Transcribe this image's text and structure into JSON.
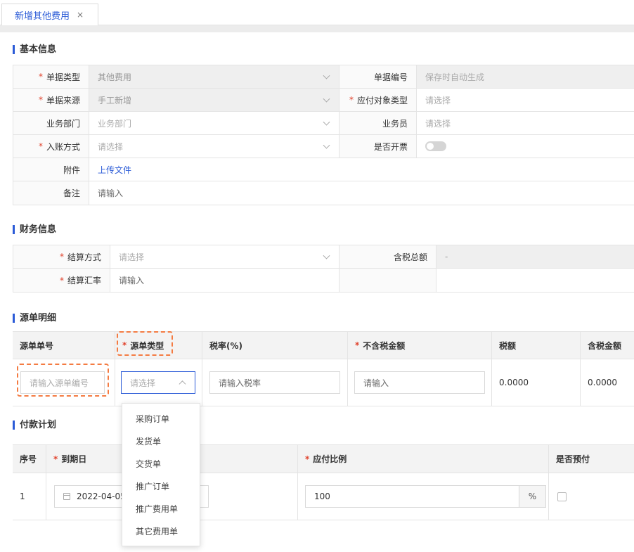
{
  "tab": {
    "label": "新增其他费用",
    "close": "×"
  },
  "basic": {
    "title": "基本信息",
    "doc_type_label": "单据类型",
    "doc_type_value": "其他费用",
    "doc_no_label": "单据编号",
    "doc_no_placeholder": "保存时自动生成",
    "doc_source_label": "单据来源",
    "doc_source_value": "手工新增",
    "payable_type_label": "应付对象类型",
    "payable_type_placeholder": "请选择",
    "dept_label": "业务部门",
    "dept_placeholder": "业务部门",
    "salesman_label": "业务员",
    "salesman_placeholder": "请选择",
    "entry_label": "入账方式",
    "entry_placeholder": "请选择",
    "invoice_label": "是否开票",
    "attach_label": "附件",
    "attach_link": "上传文件",
    "remark_label": "备注",
    "remark_placeholder": "请输入"
  },
  "finance": {
    "title": "财务信息",
    "settle_method_label": "结算方式",
    "settle_method_placeholder": "请选择",
    "tax_total_label": "含税总额",
    "tax_total_value": "-",
    "settle_rate_label": "结算汇率",
    "settle_rate_placeholder": "请输入"
  },
  "source": {
    "title": "源单明细",
    "headers": {
      "doc_no": "源单单号",
      "doc_type": "源单类型",
      "tax_rate": "税率(%)",
      "amount_ex": "不含税金额",
      "tax": "税额",
      "amount_inc": "含税金额"
    },
    "doc_no_placeholder": "请输入源单编号",
    "doc_type_placeholder": "请选择",
    "tax_rate_placeholder": "请输入税率",
    "amount_placeholder": "请输入",
    "tax_value": "0.0000",
    "amount_inc_value": "0.0000",
    "options": [
      "采购订单",
      "发货单",
      "交货单",
      "推广订单",
      "推广费用单",
      "其它费用单"
    ]
  },
  "plan": {
    "title": "付款计划",
    "headers": {
      "seq": "序号",
      "due": "到期日",
      "ratio": "应付比例",
      "prepay": "是否预付"
    },
    "row": {
      "seq": "1",
      "due": "2022-04-05",
      "ratio": "100",
      "unit": "%"
    }
  },
  "colors": {
    "accent": "#2b5bd7",
    "required": "#e0422c",
    "highlight": "#f47b42"
  },
  "icons": {
    "close": "close-icon",
    "chevron": "chevron-down-icon",
    "calendar": "calendar-icon"
  }
}
